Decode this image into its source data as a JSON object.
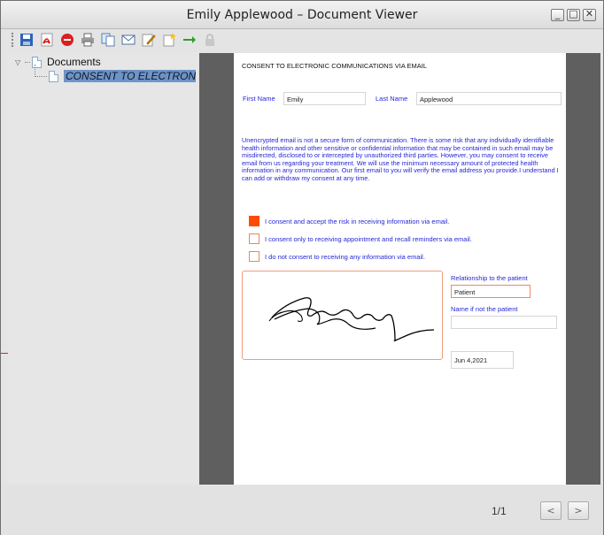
{
  "window": {
    "title": "Emily Applewood – Document Viewer"
  },
  "toolbar": {
    "icons": [
      "save-icon",
      "pdf-icon",
      "delete-icon",
      "print-icon",
      "copy-icon",
      "email-icon",
      "edit-icon",
      "new-icon",
      "forward-icon",
      "lock-icon"
    ]
  },
  "tree": {
    "root_label": "Documents",
    "child_label": "CONSENT TO ELECTRON"
  },
  "document": {
    "heading": "CONSENT TO ELECTRONIC COMMUNICATIONS VIA EMAIL",
    "first_name_label": "First Name",
    "first_name_value": "Emily",
    "last_name_label": "Last Name",
    "last_name_value": "Applewood",
    "paragraph": "Unencrypted email is not a secure form of communication. There is some risk that any individually identifiable health information and other sensitive or confidential information that may be contained in such email may be misdirected, disclosed to or intercepted by unauthorized third parties. However, you may consent to receive email from us regarding your treatment. We will use the minimum necessary amount of protected health information in any communication. Our first email to you will verify the email address you provide.I understand I can add or withdraw my consent at any time.",
    "options": [
      {
        "label": "I consent and accept the risk in receiving information via email.",
        "checked": true
      },
      {
        "label": "I consent only to receiving appointment and recall reminders via email.",
        "checked": false
      },
      {
        "label": "I do not consent to receiving any information via email.",
        "checked": false
      }
    ],
    "relationship_label": "Relationship to the patient",
    "relationship_value": "Patient",
    "name_if_not_label": "Name if not the patient",
    "name_if_not_value": "",
    "date_value": "Jun 4,2021"
  },
  "pager": {
    "text": "1/1",
    "prev": "<",
    "next": ">"
  },
  "colors": {
    "accent": "#2626d8",
    "checkbox_on": "#ff4a05",
    "selection": "#6d94c7"
  }
}
